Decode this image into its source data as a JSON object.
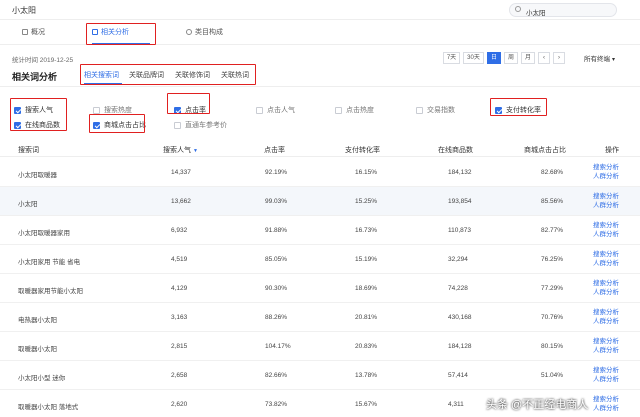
{
  "app": {
    "title": "小太阳"
  },
  "search": {
    "value": "小太阳"
  },
  "tabs": [
    {
      "label": "概况"
    },
    {
      "label": "相关分析"
    },
    {
      "label": "类目构成"
    }
  ],
  "stat": {
    "time": "统计时间 2019-12-25"
  },
  "ranges": {
    "d7": "7天",
    "d30": "30天",
    "day": "日",
    "week": "周",
    "month": "月"
  },
  "terminal": "所有终端",
  "section": {
    "title": "相关词分析"
  },
  "subtabs": [
    "相关搜索词",
    "关联品牌词",
    "关联修饰词",
    "关联热词"
  ],
  "metrics": [
    {
      "label": "搜索人气",
      "checked": true
    },
    {
      "label": "搜索热度",
      "checked": false
    },
    {
      "label": "点击率",
      "checked": true
    },
    {
      "label": "点击人气",
      "checked": false
    },
    {
      "label": "点击热度",
      "checked": false
    },
    {
      "label": "交易指数",
      "checked": false
    },
    {
      "label": "支付转化率",
      "checked": true
    },
    {
      "label": "在线商品数",
      "checked": true
    },
    {
      "label": "商城点击占比",
      "checked": true
    },
    {
      "label": "直通车参考价",
      "checked": false
    }
  ],
  "table": {
    "headers": [
      "搜索词",
      "搜索人气",
      "点击率",
      "支付转化率",
      "在线商品数",
      "商城点击占比",
      "操作"
    ],
    "rows": [
      {
        "word": "小太阳取暖器",
        "popularity": "14,337",
        "ctr": "92.19%",
        "conversion": "16.15%",
        "items": "184,132",
        "mall": "82.68%"
      },
      {
        "word": "小太阳",
        "popularity": "13,662",
        "ctr": "99.03%",
        "conversion": "15.25%",
        "items": "193,854",
        "mall": "85.56%"
      },
      {
        "word": "小太阳取暖器家用",
        "popularity": "6,932",
        "ctr": "91.88%",
        "conversion": "16.73%",
        "items": "110,873",
        "mall": "82.77%"
      },
      {
        "word": "小太阳家用 节能 省电",
        "popularity": "4,519",
        "ctr": "85.05%",
        "conversion": "15.19%",
        "items": "32,294",
        "mall": "76.25%"
      },
      {
        "word": "取暖器家用节能小太阳",
        "popularity": "4,129",
        "ctr": "90.30%",
        "conversion": "18.69%",
        "items": "74,228",
        "mall": "77.29%"
      },
      {
        "word": "电热器小太阳",
        "popularity": "3,163",
        "ctr": "88.26%",
        "conversion": "20.81%",
        "items": "430,168",
        "mall": "70.76%"
      },
      {
        "word": "取暖器小太阳",
        "popularity": "2,815",
        "ctr": "104.17%",
        "conversion": "20.83%",
        "items": "184,128",
        "mall": "80.15%"
      },
      {
        "word": "小太阳小型 迷你",
        "popularity": "2,658",
        "ctr": "82.66%",
        "conversion": "13.78%",
        "items": "57,414",
        "mall": "51.04%"
      },
      {
        "word": "取暖器小太阳 落地式",
        "popularity": "2,620",
        "ctr": "73.82%",
        "conversion": "15.67%",
        "items": "4,311",
        "mall": ""
      }
    ],
    "action1": "搜索分析",
    "action2": "人群分析"
  },
  "watermark": "头条 @不正经电商人",
  "colors": {
    "accent": "#2f6ee6",
    "highlight": "#e02020"
  }
}
